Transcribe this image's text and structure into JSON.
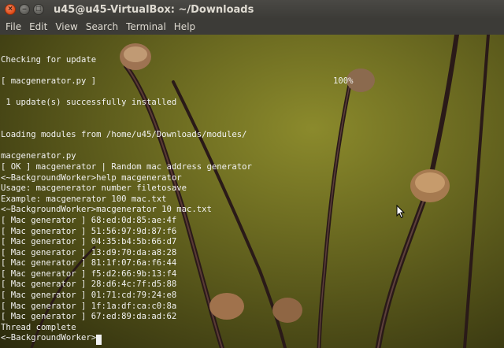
{
  "window": {
    "title": "u45@u45-VirtualBox: ~/Downloads",
    "close_glyph": "×",
    "minimize_glyph": "–",
    "maximize_glyph": "□"
  },
  "menu": [
    "File",
    "Edit",
    "View",
    "Search",
    "Terminal",
    "Help"
  ],
  "terminal": {
    "update_lines": {
      "checking": "Checking for update",
      "file_progress": "[ macgenerator.py ]",
      "percent": "100%",
      "installed": " 1 update(s) successfully installed"
    },
    "loading": "Loading modules from /home/u45/Downloads/modules/",
    "module_lines": [
      "macgenerator.py",
      "[ OK ] macgenerator | Random mac address generator",
      "<~BackgroundWorker>help macgenerator",
      "Usage: macgenerator number filetosave",
      "Example: macgenerator 100 mac.txt",
      "<~BackgroundWorker>macgenerator 10 mac.txt"
    ],
    "mac_lines": [
      "[ Mac generator ] 68:ed:0d:85:ae:4f",
      "[ Mac generator ] 51:56:97:9d:87:f6",
      "[ Mac generator ] 04:35:b4:5b:66:d7",
      "[ Mac generator ] 13:d9:70:da:a8:28",
      "[ Mac generator ] 81:1f:07:6a:f6:44",
      "[ Mac generator ] f5:d2:66:9b:13:f4",
      "[ Mac generator ] 28:d6:4c:7f:d5:88",
      "[ Mac generator ] 01:71:cd:79:24:e8",
      "[ Mac generator ] 1f:1a:df:ca:c0:8a",
      "[ Mac generator ] 67:ed:89:da:ad:62"
    ],
    "complete": "Thread complete",
    "prompt": "<~BackgroundWorker>"
  }
}
